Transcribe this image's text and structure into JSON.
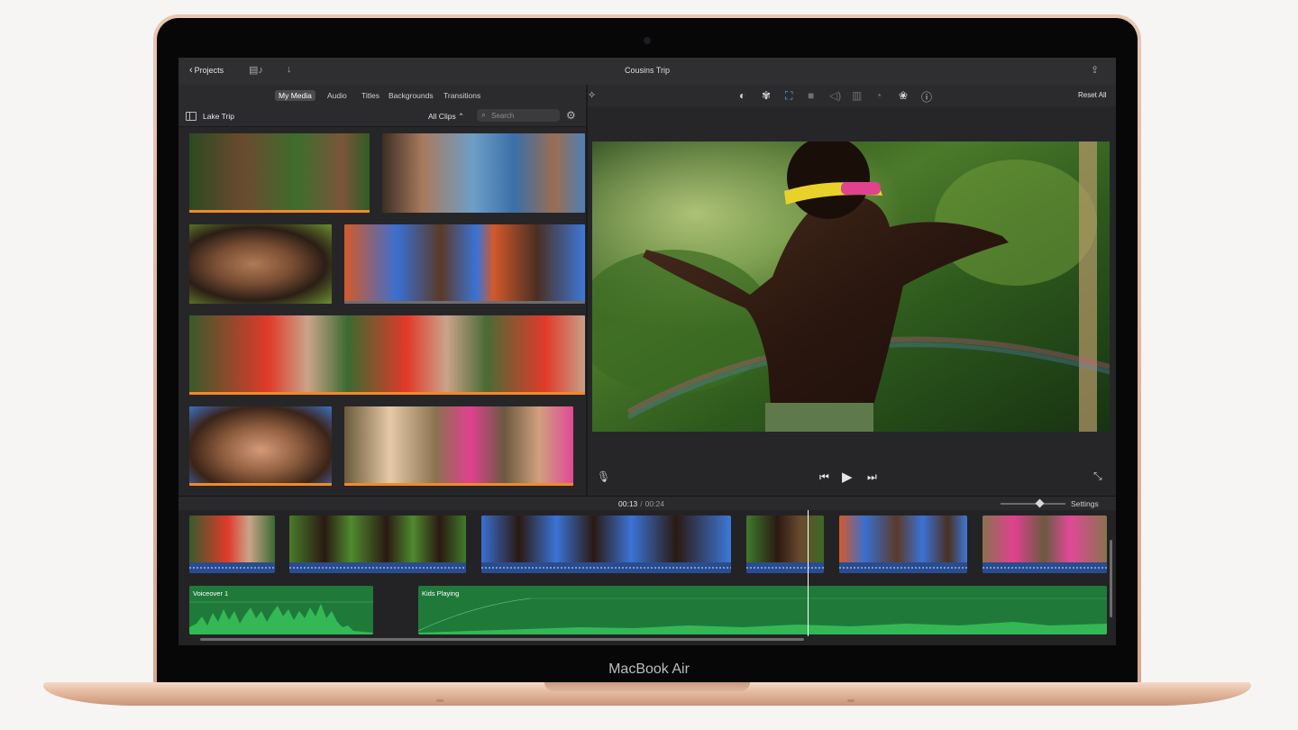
{
  "device": {
    "brand_label": "MacBook Air"
  },
  "toolbar": {
    "back_label": "Projects",
    "project_title": "Cousins Trip",
    "icons": [
      "chevron-left-icon",
      "storyboard-icon",
      "download-arrow-icon",
      "share-icon"
    ]
  },
  "browser": {
    "tabs": [
      {
        "label": "My Media",
        "active": true
      },
      {
        "label": "Audio",
        "active": false
      },
      {
        "label": "Titles",
        "active": false
      },
      {
        "label": "Backgrounds",
        "active": false
      },
      {
        "label": "Transitions",
        "active": false
      }
    ],
    "library_name": "Lake Trip",
    "filter_label": "All Clips ⌃",
    "search": {
      "value": "",
      "placeholder": "Search"
    },
    "used_marker_color": "#f08a2a"
  },
  "viewer": {
    "reset_label": "Reset All",
    "adjust_icons": [
      "magic-wand-icon",
      "color-balance-icon",
      "color-palette-icon",
      "crop-icon",
      "stabilization-icon",
      "volume-icon",
      "equalizer-icon",
      "speed-icon",
      "noise-reduction-icon",
      "info-icon"
    ],
    "selected_tool": "crop-icon",
    "playback_icons": [
      "voiceover-mic-icon",
      "skip-back-icon",
      "play-icon",
      "skip-forward-icon",
      "fullscreen-icon"
    ]
  },
  "timeline": {
    "current_time": "00:13",
    "duration": "00:24",
    "settings_label": "Settings",
    "audio_tracks": [
      {
        "label": "Voiceover 1"
      },
      {
        "label": "Kids Playing"
      }
    ],
    "audio_color": "#1f7a3a",
    "video_audio_color": "#2b4c8c"
  }
}
